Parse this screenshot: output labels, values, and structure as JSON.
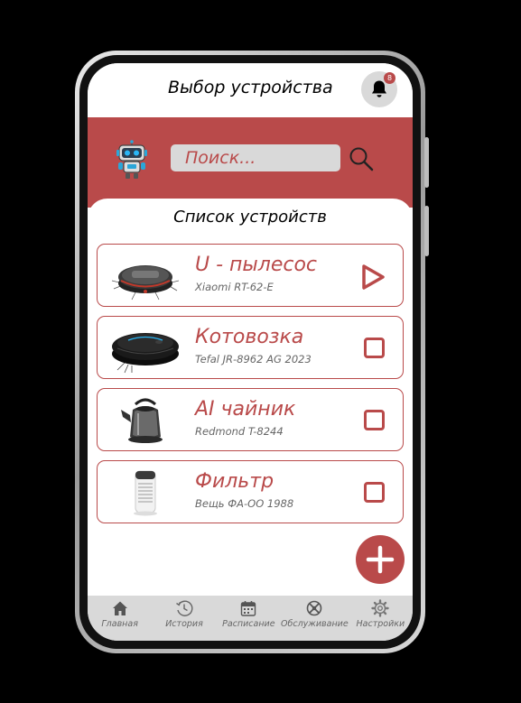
{
  "header": {
    "title": "Выбор устройства",
    "notification_count": "8"
  },
  "search": {
    "placeholder": "Поиск..."
  },
  "list": {
    "title": "Список устройств"
  },
  "devices": [
    {
      "name": "U - пылесос",
      "model": "Xiaomi RT-62-E",
      "action": "play"
    },
    {
      "name": "Котовозка",
      "model": "Tefal JR-8962 AG 2023",
      "action": "checkbox"
    },
    {
      "name": "AI чайник",
      "model": "Redmond T-8244",
      "action": "checkbox"
    },
    {
      "name": "Фильтр",
      "model": "Вещь ФА-ОО 1988",
      "action": "checkbox"
    }
  ],
  "nav": [
    {
      "label": "Главная",
      "icon": "home-icon"
    },
    {
      "label": "История",
      "icon": "history-icon"
    },
    {
      "label": "Расписание",
      "icon": "calendar-icon"
    },
    {
      "label": "Обслуживание",
      "icon": "service-icon"
    },
    {
      "label": "Настройки",
      "icon": "gear-icon"
    }
  ],
  "colors": {
    "accent": "#b94a4a",
    "surface": "#d9d9d9",
    "text": "#000000",
    "muted": "#666666"
  }
}
